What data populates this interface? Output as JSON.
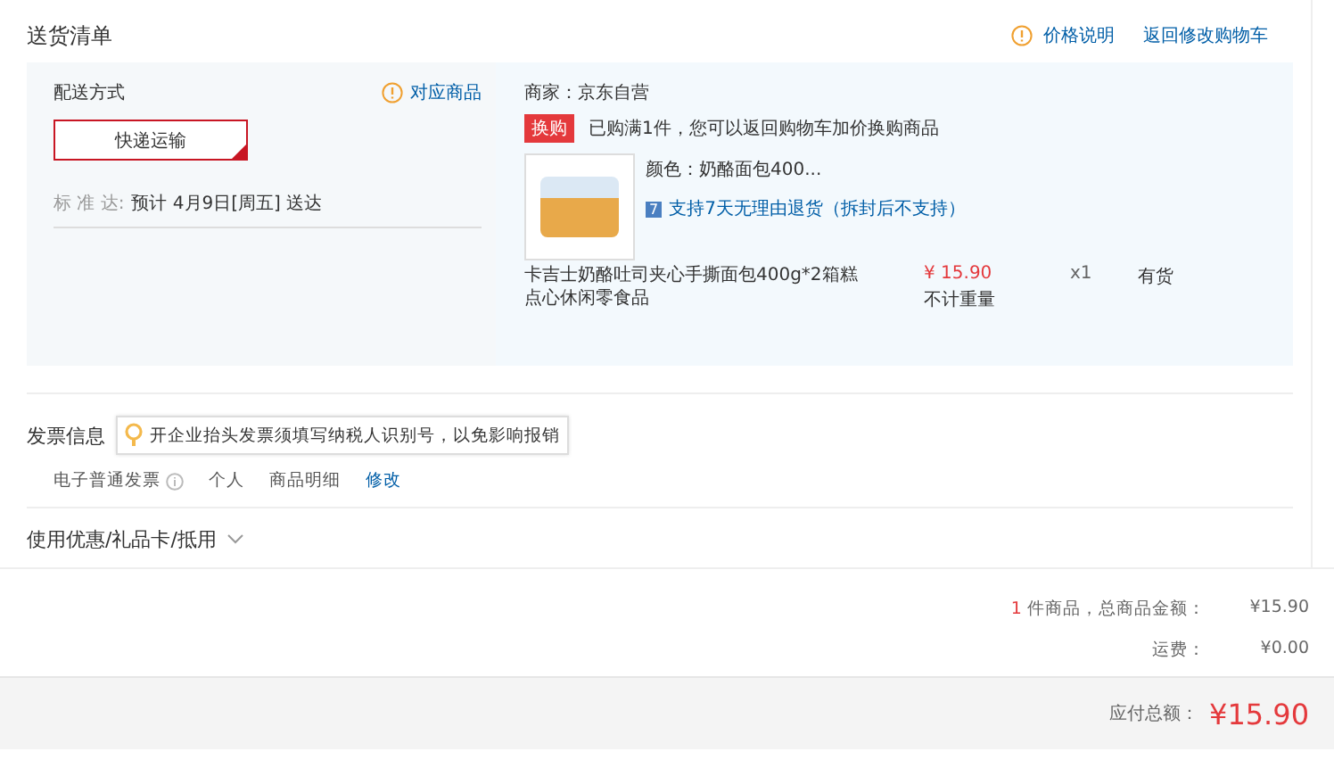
{
  "section_title": "送货清单",
  "header_links": [
    {
      "kind": "info",
      "label": "价格说明"
    },
    {
      "kind": "plain",
      "label": "返回修改购物车"
    }
  ],
  "shipping": {
    "label": "配送方式",
    "link": "对应商品",
    "method": {
      "label": "快递运输",
      "selected": true
    },
    "eta_label": "标 准 达:",
    "eta": "预计 4月9日[周五] 送达"
  },
  "merchant": "商家：京东自营",
  "promo": {
    "tag": "换购",
    "text": "已购满1件，您可以返回购物车加价换购商品"
  },
  "product": {
    "variant": "颜色：奶酪面包400...",
    "return_badge": "7",
    "return_policy": "支持7天无理由退货（拆封后不支持）",
    "name": "卡吉士奶酪吐司夹心手撕面包400g*2箱糕点心休闲零食品",
    "price": "¥ 15.90",
    "weight_note": "不计重量",
    "quantity": "x1",
    "stock": "有货"
  },
  "invoice": {
    "title": "发票信息",
    "tip": "开企业抬头发票须填写纳税人识别号，以免影响报销",
    "type": "电子普通发票",
    "holder": "个人",
    "content": "商品明细",
    "edit": "修改"
  },
  "coupon": {
    "label": "使用优惠/礼品卡/抵用",
    "expanded": false
  },
  "summary": {
    "count": "1",
    "count_text": "件商品，总商品金额：",
    "subtotal": "¥15.90",
    "shipping_label": "运费：",
    "shipping_fee": "¥0.00"
  },
  "total": {
    "label": "应付总额：",
    "amount": "¥15.90"
  }
}
